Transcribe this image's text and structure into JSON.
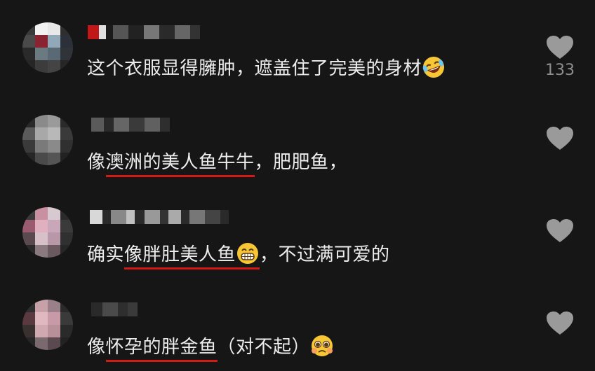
{
  "comments": [
    {
      "text_before": "这个衣服显得臃肿，遮盖住了完美的身材",
      "underlined": "",
      "text_after": "",
      "emoji": "rolling-laughing-emoji",
      "like_count": "133"
    },
    {
      "text_before": "像",
      "underlined": "澳洲的美人鱼牛牛",
      "text_after": "，肥肥鱼，",
      "emoji": "",
      "like_count": ""
    },
    {
      "text_before": "确实",
      "underlined": "像胖肚美人鱼",
      "text_after": "，不过满可爱的",
      "emoji": "grinning-emoji",
      "like_count": ""
    },
    {
      "text_before": "像",
      "underlined": "怀孕的胖金鱼",
      "text_after": "（对不起）",
      "emoji": "pleading-emoji",
      "like_count": ""
    }
  ],
  "colors": {
    "background": "#161616",
    "underline": "#d41a16",
    "like_icon": "#9a9a9a"
  }
}
